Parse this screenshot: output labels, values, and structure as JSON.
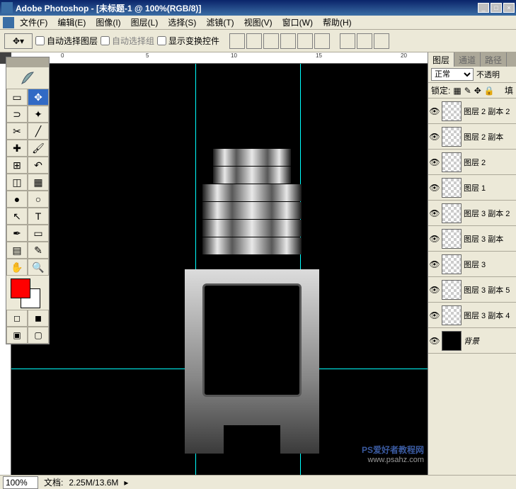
{
  "title": "Adobe Photoshop - [未标题-1 @ 100%(RGB/8)]",
  "window_controls": {
    "min": "_",
    "max": "□",
    "close": "×"
  },
  "menu": {
    "file": "文件(F)",
    "edit": "编辑(E)",
    "image": "图像(I)",
    "layer": "图层(L)",
    "select": "选择(S)",
    "filter": "滤镜(T)",
    "view": "视图(V)",
    "window": "窗口(W)",
    "help": "帮助(H)"
  },
  "options": {
    "auto_select_layer": "自动选择图层",
    "auto_select_group": "自动选择组",
    "show_transform": "显示变换控件"
  },
  "toolbox": {
    "feather_icon": "feather"
  },
  "colors": {
    "fg": "#ff0000",
    "bg": "#ffffff"
  },
  "ruler_marks": [
    "0",
    "5",
    "10",
    "15",
    "20"
  ],
  "panels": {
    "tabs": {
      "layers": "图层",
      "channels": "通道",
      "paths": "路径"
    },
    "blend_mode": "正常",
    "opacity_label": "不透明",
    "lock_label": "锁定:",
    "fill_label": "填",
    "layers": [
      {
        "name": "图层 2 副本 2",
        "vis": true,
        "thumb": "checker"
      },
      {
        "name": "图层 2 副本",
        "vis": true,
        "thumb": "checker"
      },
      {
        "name": "图层 2",
        "vis": true,
        "thumb": "checker"
      },
      {
        "name": "图层 1",
        "vis": true,
        "thumb": "checker"
      },
      {
        "name": "图层 3 副本 2",
        "vis": true,
        "thumb": "checker"
      },
      {
        "name": "图层 3 副本",
        "vis": true,
        "thumb": "checker"
      },
      {
        "name": "图层 3",
        "vis": true,
        "thumb": "checker"
      },
      {
        "name": "图层 3 副本 5",
        "vis": true,
        "thumb": "checker"
      },
      {
        "name": "图层 3 副本 4",
        "vis": true,
        "thumb": "checker"
      },
      {
        "name": "背景",
        "vis": true,
        "thumb": "black"
      }
    ]
  },
  "status": {
    "zoom": "100%",
    "doc_label": "文档:",
    "doc_size": "2.25M/13.6M"
  },
  "watermark": {
    "main": "PS爱好者教程网",
    "sub": "www.psahz.com"
  }
}
